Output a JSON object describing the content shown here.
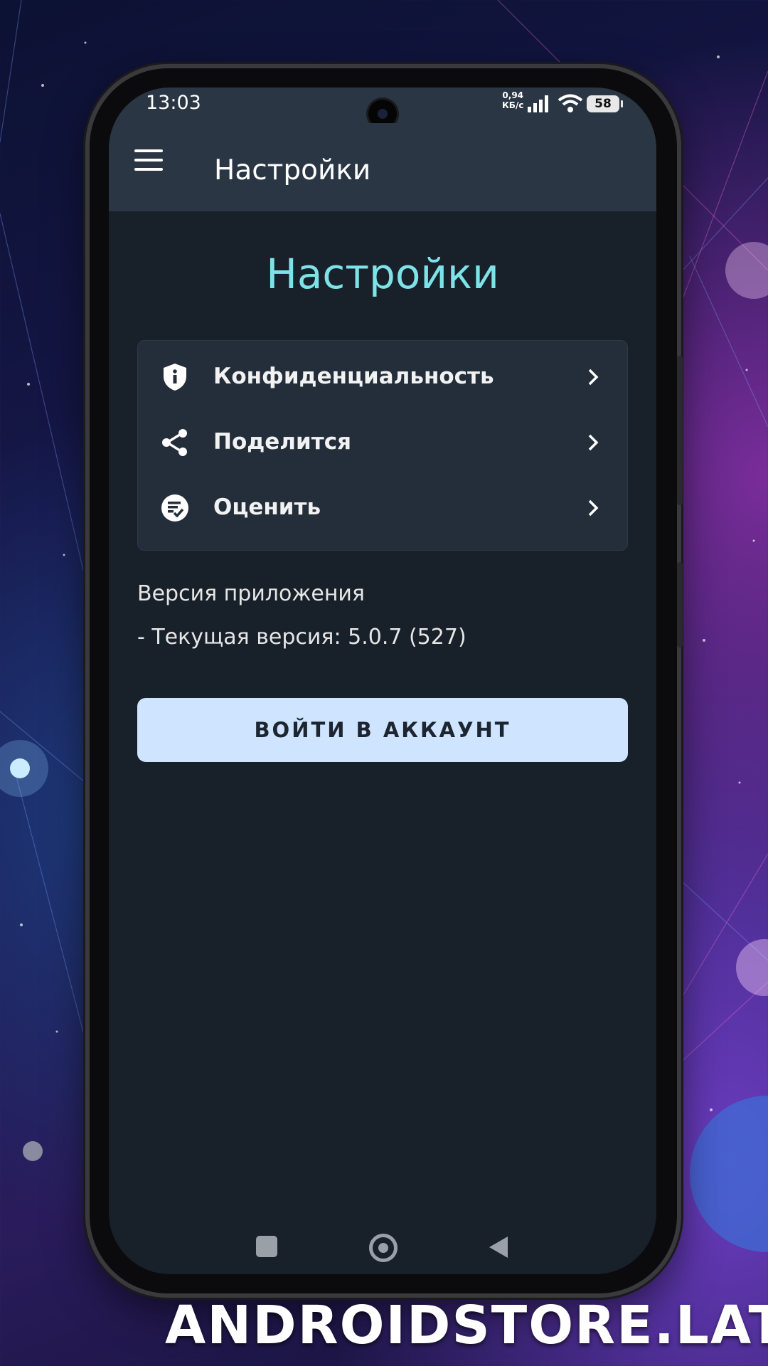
{
  "status_bar": {
    "time": "13:03",
    "net_speed_value": "0,94",
    "net_speed_unit": "КБ/с",
    "battery": "58"
  },
  "app_bar": {
    "title": "Настройки"
  },
  "page": {
    "heading": "Настройки",
    "menu_items": [
      {
        "label": "Конфиденциальность",
        "icon": "shield-info-icon"
      },
      {
        "label": "Поделится",
        "icon": "share-icon"
      },
      {
        "label": "Оценить",
        "icon": "rate-icon"
      }
    ],
    "version_heading": "Версия приложения",
    "version_line": "- Текущая версия: 5.0.7 (527)",
    "login_button": "ВОЙТИ В АККАУНТ"
  },
  "watermark": "ANDROIDSTORE.LAT",
  "colors": {
    "app_bar_bg": "#2a3644",
    "screen_bg": "#18202a",
    "card_bg": "#232e3a",
    "heading_accent": "#7de3e8",
    "button_bg": "#cfe4ff"
  }
}
